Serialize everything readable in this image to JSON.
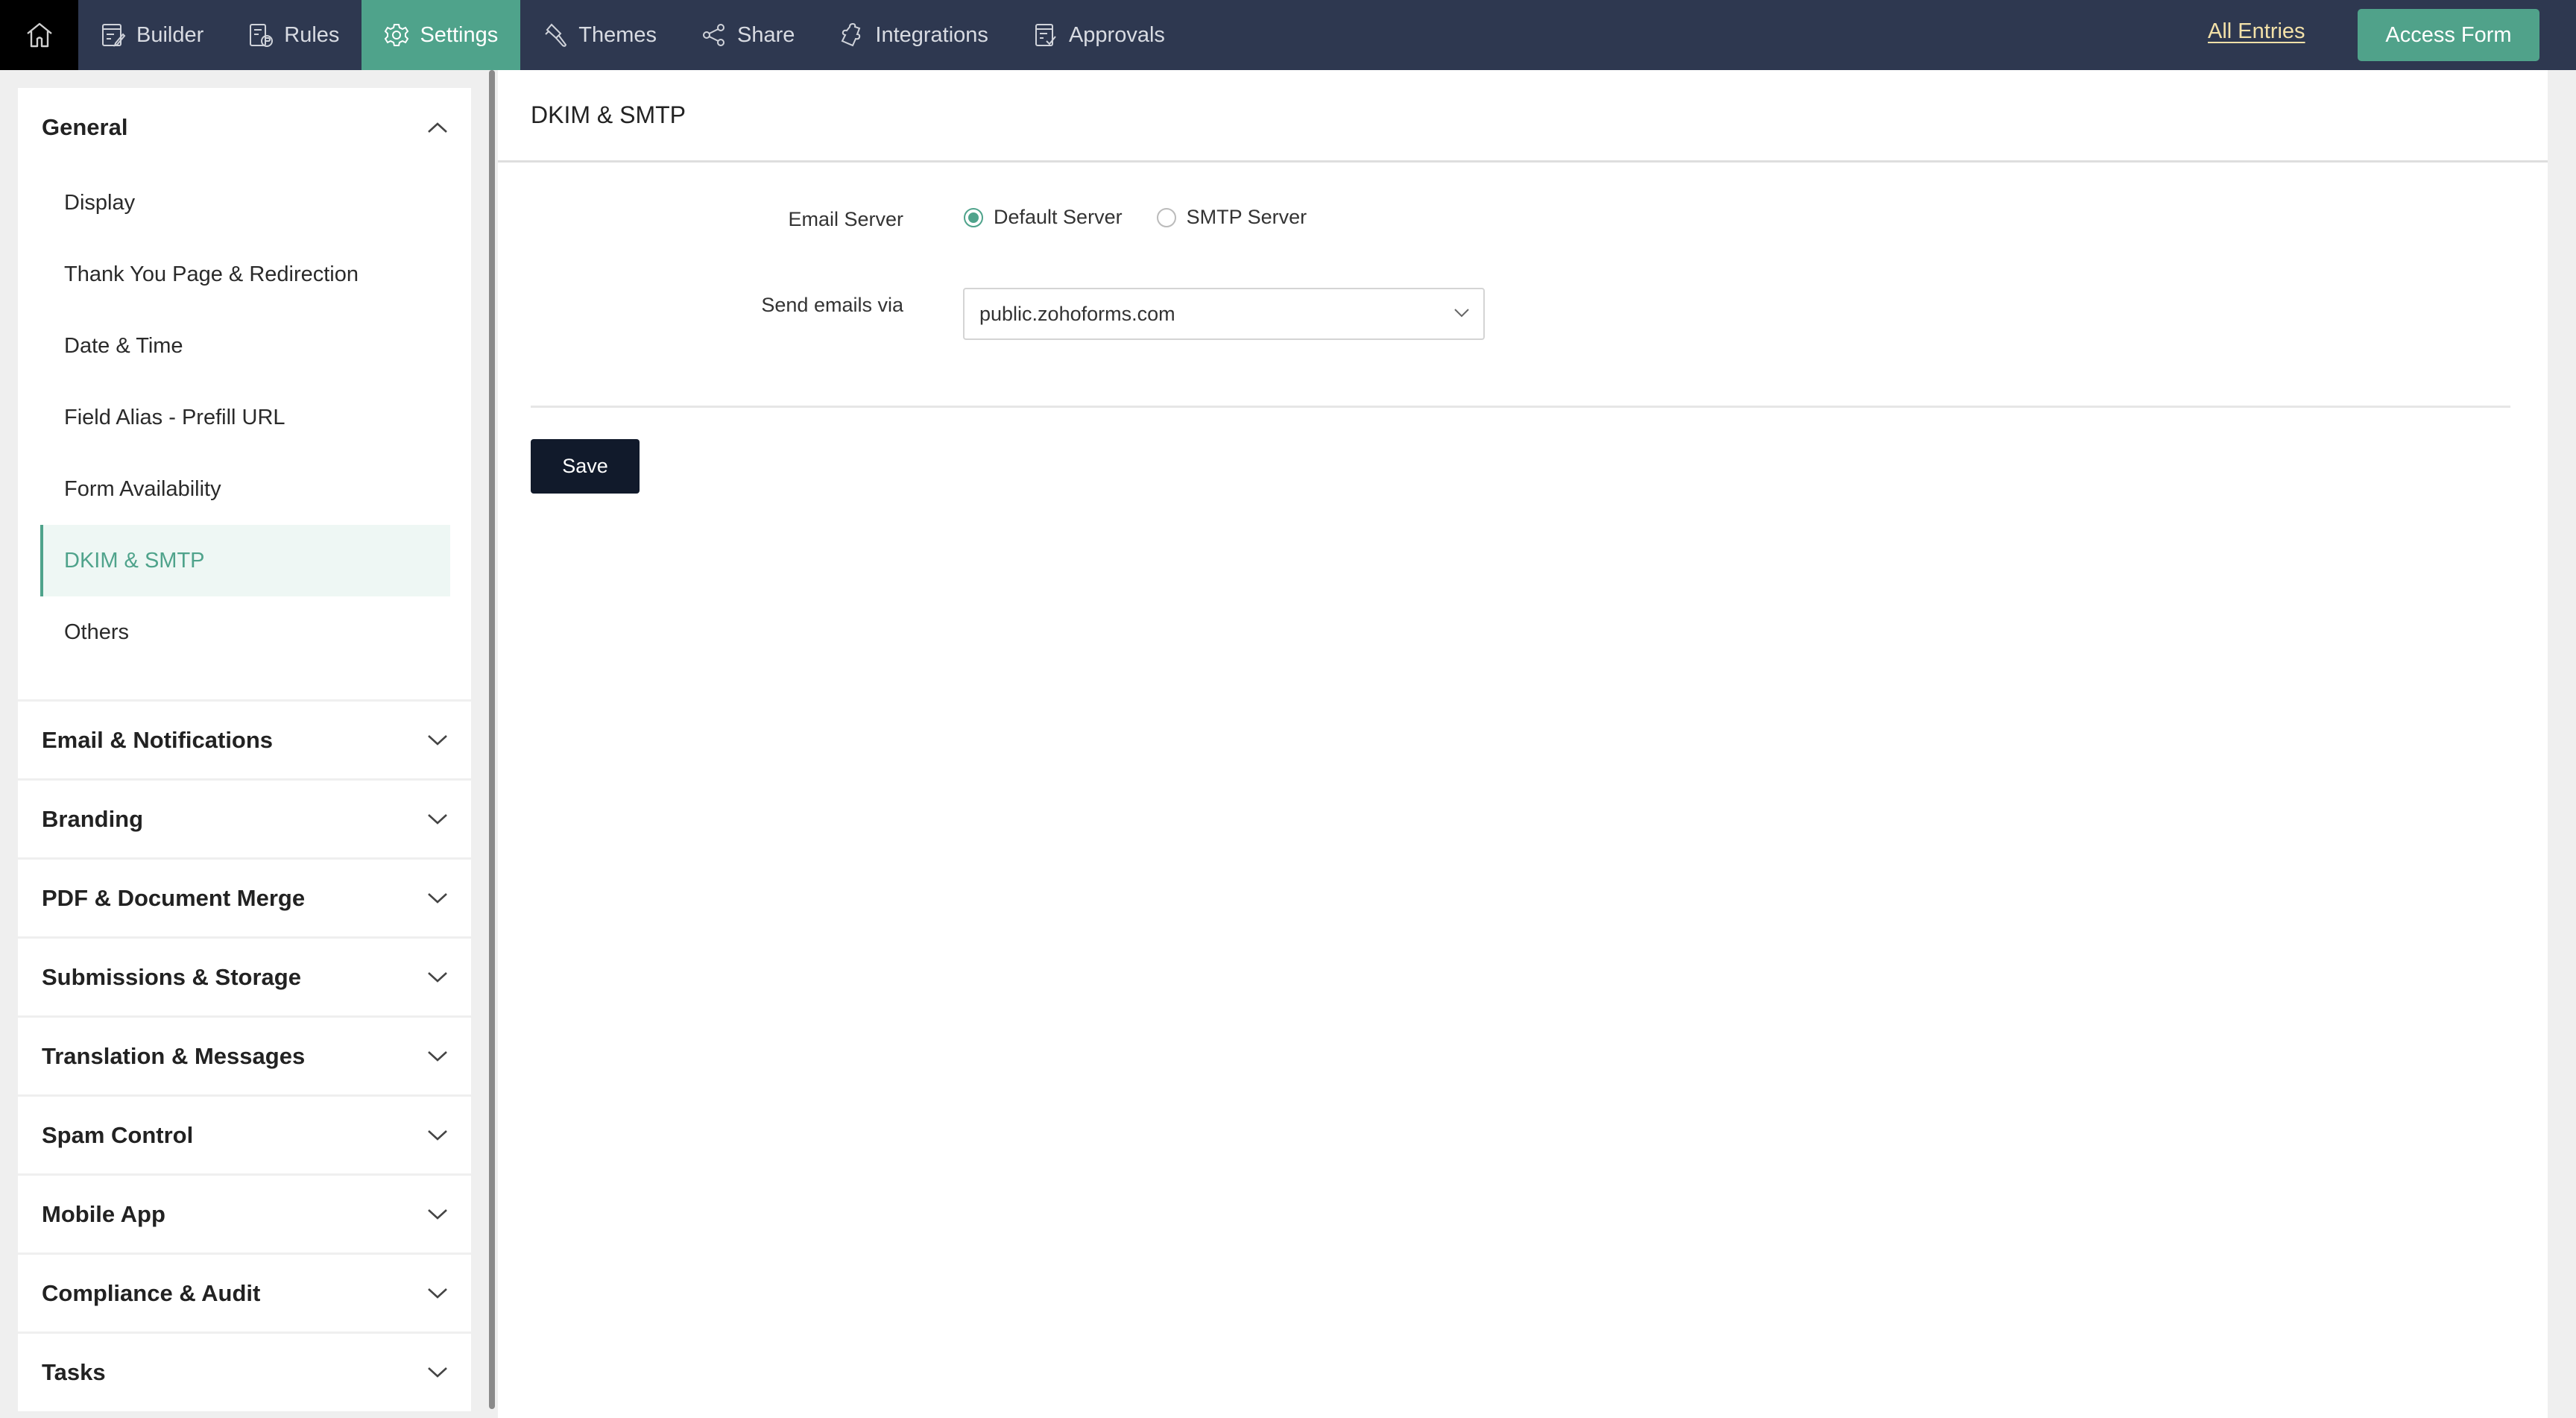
{
  "topbar": {
    "home_icon": "home-icon",
    "nav": [
      {
        "label": "Builder",
        "icon": "builder-icon",
        "active": false
      },
      {
        "label": "Rules",
        "icon": "rules-icon",
        "active": false
      },
      {
        "label": "Settings",
        "icon": "gear-icon",
        "active": true
      },
      {
        "label": "Themes",
        "icon": "themes-brush-icon",
        "active": false
      },
      {
        "label": "Share",
        "icon": "share-icon",
        "active": false
      },
      {
        "label": "Integrations",
        "icon": "puzzle-icon",
        "active": false
      },
      {
        "label": "Approvals",
        "icon": "approvals-icon",
        "active": false
      }
    ],
    "all_entries": "All Entries",
    "access_form": "Access Form"
  },
  "sidebar": {
    "general": {
      "label": "General",
      "expanded": true,
      "items": [
        {
          "label": "Display",
          "active": false
        },
        {
          "label": "Thank You Page & Redirection",
          "active": false
        },
        {
          "label": "Date & Time",
          "active": false
        },
        {
          "label": "Field Alias - Prefill URL",
          "active": false
        },
        {
          "label": "Form Availability",
          "active": false
        },
        {
          "label": "DKIM & SMTP",
          "active": true
        },
        {
          "label": "Others",
          "active": false
        }
      ]
    },
    "groups": [
      {
        "label": "Email & Notifications"
      },
      {
        "label": "Branding"
      },
      {
        "label": "PDF & Document Merge"
      },
      {
        "label": "Submissions & Storage"
      },
      {
        "label": "Translation & Messages"
      },
      {
        "label": "Spam Control"
      },
      {
        "label": "Mobile App"
      },
      {
        "label": "Compliance & Audit"
      },
      {
        "label": "Tasks"
      }
    ]
  },
  "main": {
    "title": "DKIM & SMTP",
    "email_server": {
      "label": "Email Server",
      "options": [
        {
          "label": "Default Server",
          "checked": true
        },
        {
          "label": "SMTP Server",
          "checked": false
        }
      ]
    },
    "send_via": {
      "label": "Send emails via",
      "value": "public.zohoforms.com"
    },
    "save_label": "Save"
  },
  "colors": {
    "topbar": "#2e3850",
    "accent": "#4fa38b",
    "all_entries_link": "#f3e1a8",
    "save_button": "#111a2b"
  }
}
